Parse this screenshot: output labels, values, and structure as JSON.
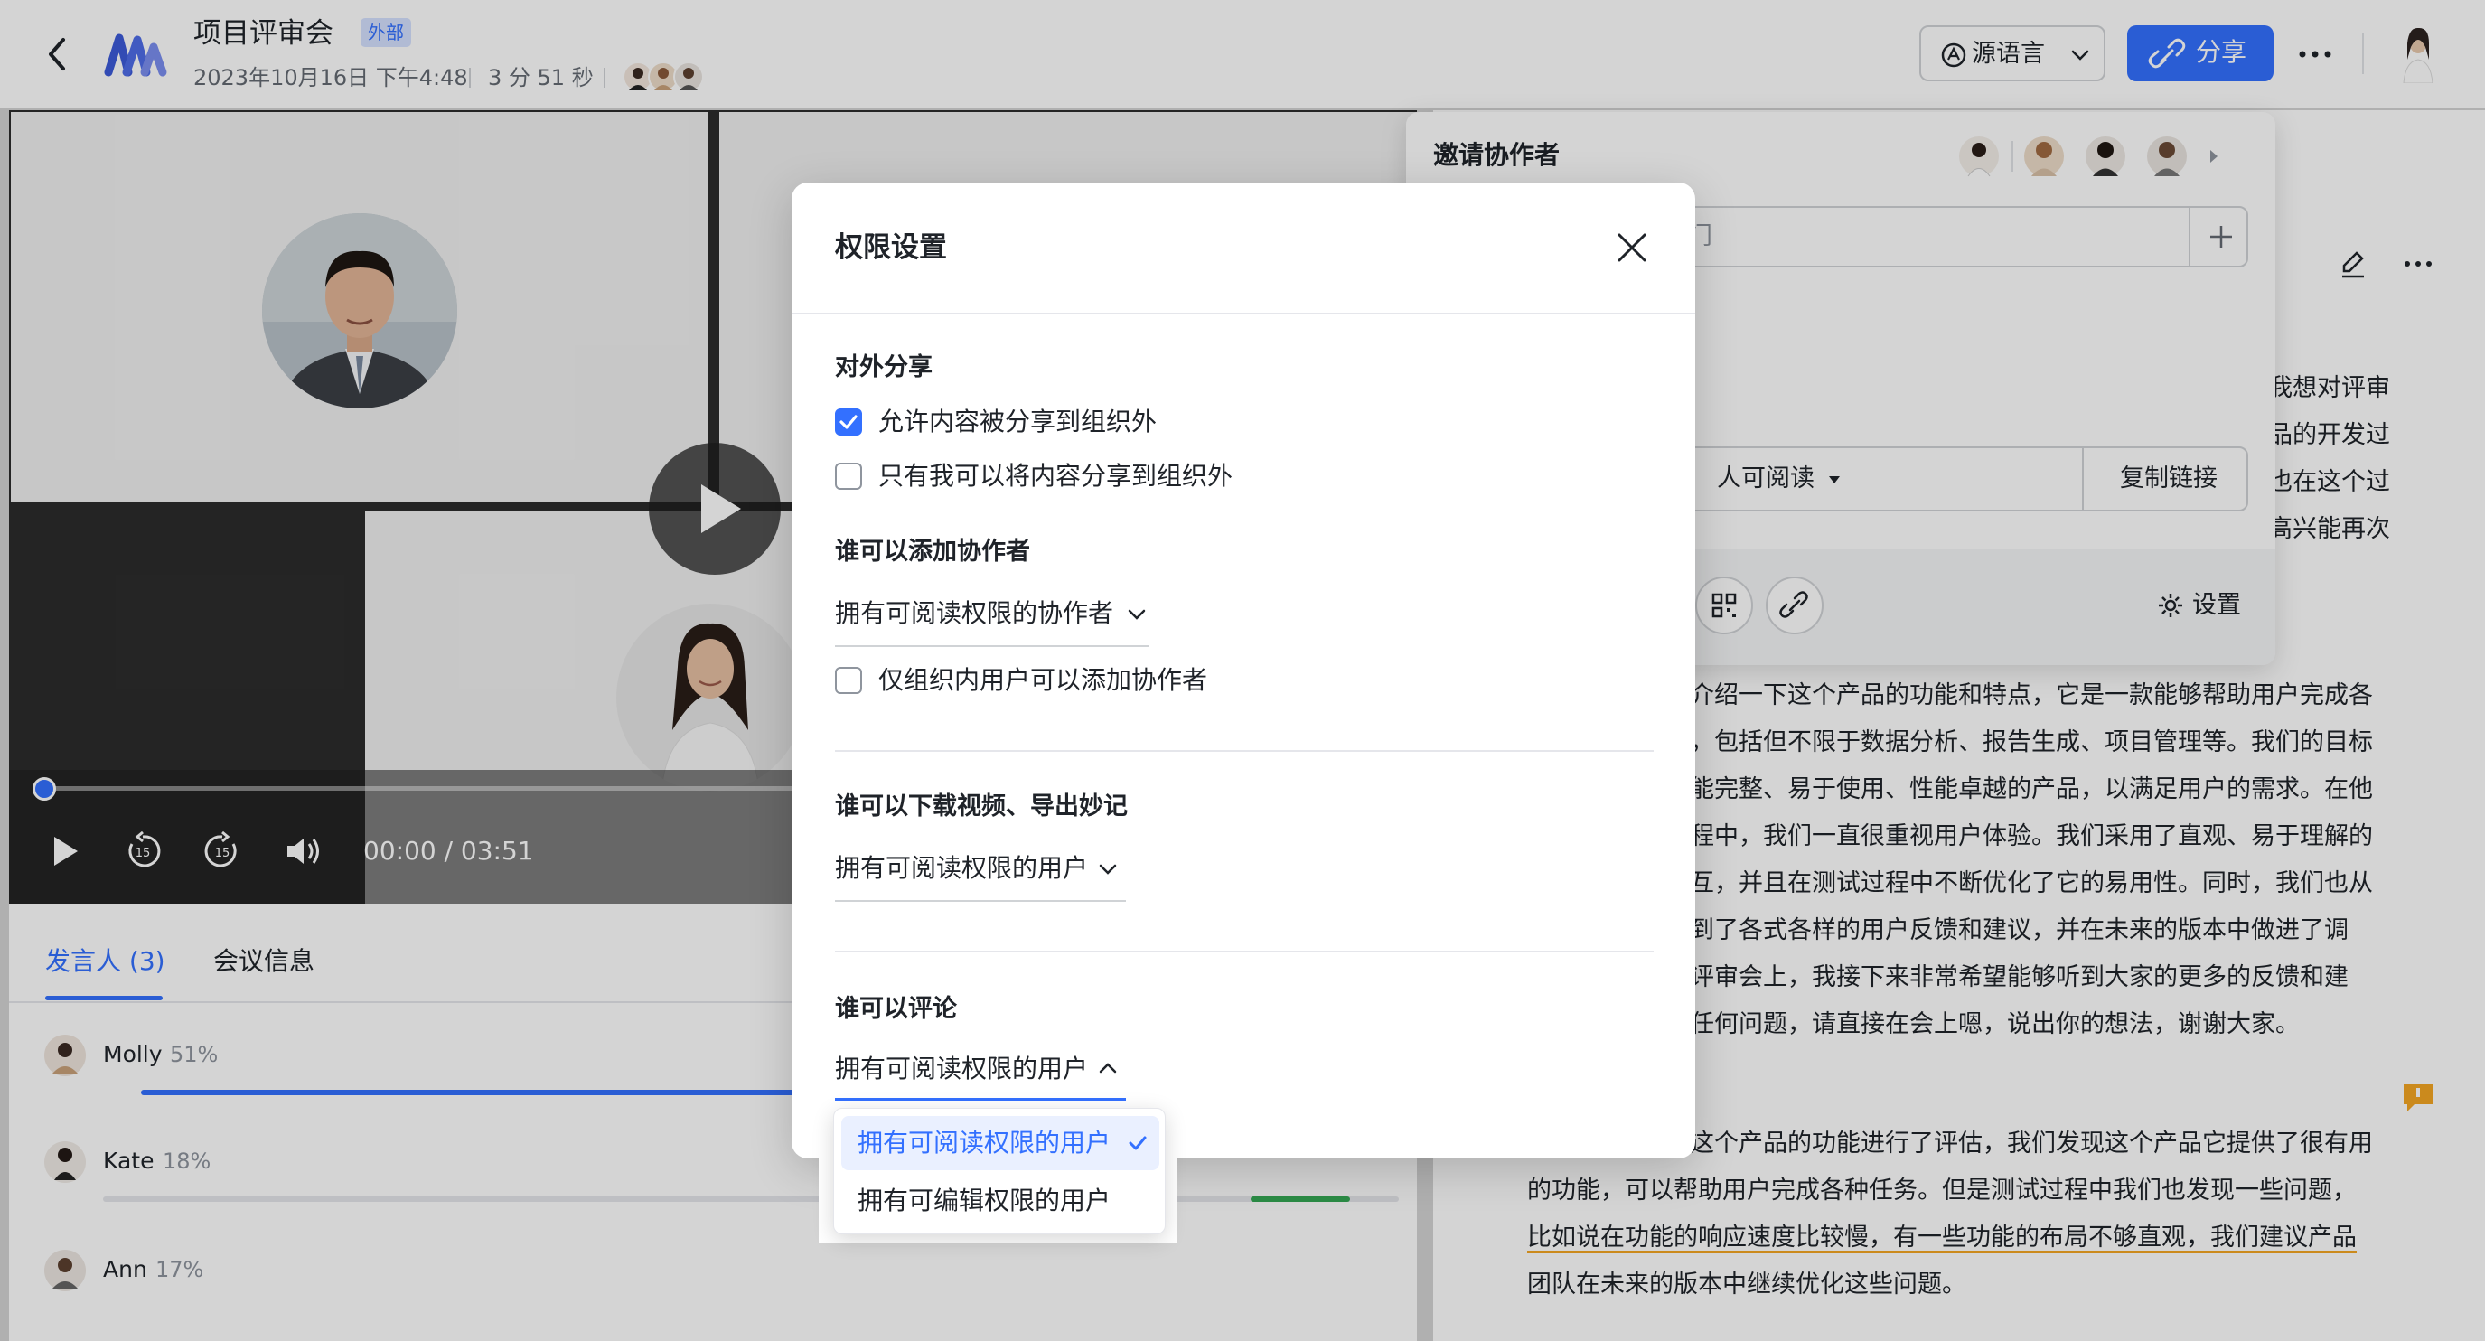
{
  "header": {
    "title": "项目评审会",
    "tag": "外部",
    "datetime": "2023年10月16日 下午4:48",
    "duration": "3 分 51 秒",
    "lang_button": "源语言",
    "share_button": "分享"
  },
  "player": {
    "time": "00:00 / 03:51",
    "progress": 0
  },
  "tabs": {
    "speakers": "发言人 (3)",
    "meeting_info": "会议信息"
  },
  "speakers": [
    {
      "name": "Molly",
      "pct": "51%"
    },
    {
      "name": "Kate",
      "pct": "18%"
    },
    {
      "name": "Ann",
      "pct": "17%"
    }
  ],
  "share_panel": {
    "invite_title": "邀请协作者",
    "invite_placeholder": "门",
    "permission": "人可阅读",
    "copy_link": "复制链接",
    "settings": "设置"
  },
  "transcript": {
    "lines_top": [
      "我想对评审",
      "品的开发过",
      "也在这个过",
      "高兴能再次"
    ],
    "lines_mid": [
      "介绍一下这个产品的功能和特点，它是一款能够帮助用户完成各",
      "，包括但不限于数据分析、报告生成、项目管理等。我们的目标",
      "能完整、易于使用、性能卓越的产品，以满足用户的需求。在他",
      "程中，我们一直很重视用户体验。我们采用了直观、易于理解的",
      "互，并且在测试过程中不断优化了它的易用性。同时，我们也从",
      "到了各式各样的用户反馈和建议，并在未来的版本中做进了调",
      "评审会上，我接下来非常希望能够听到大家的更多的反馈和建",
      "任何问题，请直接在会上嗯，说出你的想法，谢谢大家。"
    ],
    "lines_bottom": [
      "这个产品的功能进行了评估，我们发现这个产品它提供了很有用",
      "的功能，可以帮助用户完成各种任务。但是测试过程中我们也发现一些问题，",
      "比如说在功能的响应速度比较慢，有一些功能的布局不够直观，我们建议产品",
      "团队在未来的版本中继续优化这些问题。"
    ]
  },
  "dialog": {
    "title": "权限设置",
    "external_section": "对外分享",
    "allow_external": "允许内容被分享到组织外",
    "allow_external_checked": true,
    "only_me_external": "只有我可以将内容分享到组织外",
    "only_me_external_checked": false,
    "add_collab_section": "谁可以添加协作者",
    "add_collab_value": "拥有可阅读权限的协作者",
    "only_org_add": "仅组织内用户可以添加协作者",
    "only_org_add_checked": false,
    "download_section": "谁可以下载视频、导出妙记",
    "download_value": "拥有可阅读权限的用户",
    "comment_section": "谁可以评论",
    "comment_value": "拥有可阅读权限的用户",
    "comment_options": [
      "拥有可阅读权限的用户",
      "拥有可编辑权限的用户"
    ],
    "comment_selected": 0
  },
  "colors": {
    "accent": "#3370ff",
    "overlay": "rgba(0,0,0,0.17)",
    "green": "#34a853"
  }
}
